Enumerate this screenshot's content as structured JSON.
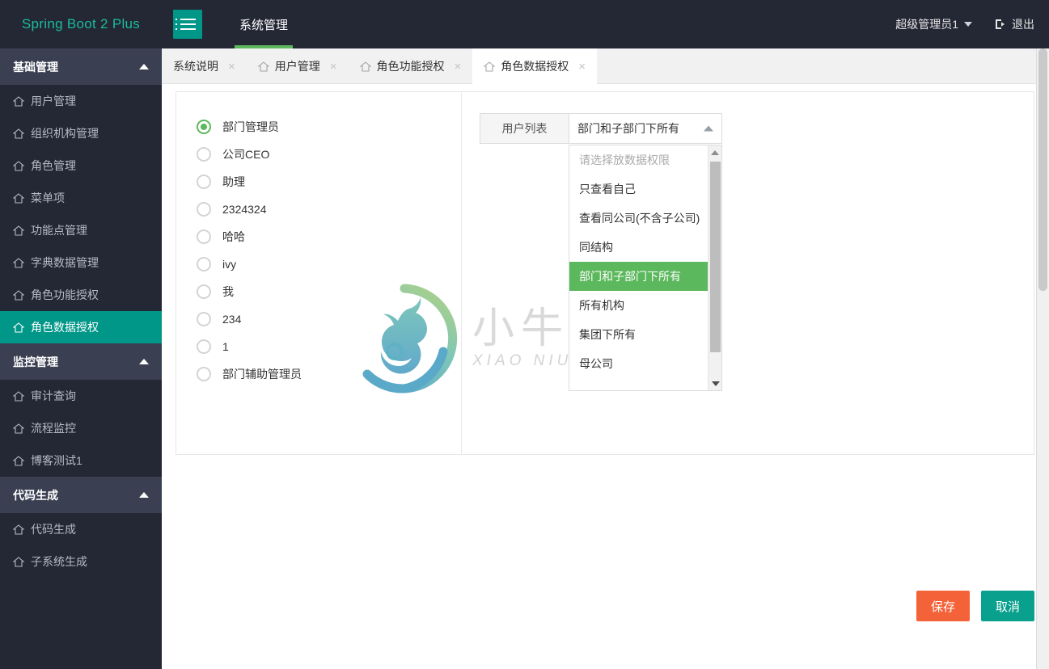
{
  "app": {
    "brand": "Spring Boot 2 Plus",
    "menu_toggle_icon": "hamburger-icon"
  },
  "topnav": {
    "items": [
      {
        "label": "系统管理",
        "active": true
      }
    ],
    "user": "超级管理员1",
    "logout_label": "退出",
    "logout_icon": "logout-icon",
    "caret_icon": "caret-down-icon"
  },
  "sidebar": {
    "groups": [
      {
        "title": "基础管理",
        "collapse_icon": "chevron-up-icon",
        "items": [
          {
            "label": "用户管理",
            "icon": "home-icon",
            "active": false
          },
          {
            "label": "组织机构管理",
            "icon": "home-icon",
            "active": false
          },
          {
            "label": "角色管理",
            "icon": "home-icon",
            "active": false
          },
          {
            "label": "菜单项",
            "icon": "home-icon",
            "active": false
          },
          {
            "label": "功能点管理",
            "icon": "home-icon",
            "active": false
          },
          {
            "label": "字典数据管理",
            "icon": "home-icon",
            "active": false
          },
          {
            "label": "角色功能授权",
            "icon": "home-icon",
            "active": false
          },
          {
            "label": "角色数据授权",
            "icon": "home-icon",
            "active": true
          }
        ]
      },
      {
        "title": "监控管理",
        "collapse_icon": "chevron-up-icon",
        "items": [
          {
            "label": "审计查询",
            "icon": "home-icon",
            "active": false
          },
          {
            "label": "流程监控",
            "icon": "home-icon",
            "active": false
          },
          {
            "label": "博客测试1",
            "icon": "home-icon",
            "active": false
          }
        ]
      },
      {
        "title": "代码生成",
        "collapse_icon": "chevron-up-icon",
        "items": [
          {
            "label": "代码生成",
            "icon": "home-icon",
            "active": false
          },
          {
            "label": "子系统生成",
            "icon": "home-icon",
            "active": false
          }
        ]
      }
    ]
  },
  "tabs": [
    {
      "label": "系统说明",
      "icon": null,
      "close": "×",
      "active": false
    },
    {
      "label": "用户管理",
      "icon": "home-icon",
      "close": "×",
      "active": false
    },
    {
      "label": "角色功能授权",
      "icon": "home-icon",
      "close": "×",
      "active": false
    },
    {
      "label": "角色数据授权",
      "icon": "home-icon",
      "close": "×",
      "active": true
    }
  ],
  "main": {
    "roles": [
      {
        "label": "部门管理员",
        "checked": true
      },
      {
        "label": "公司CEO",
        "checked": false
      },
      {
        "label": "助理",
        "checked": false
      },
      {
        "label": "2324324",
        "checked": false
      },
      {
        "label": "哈哈",
        "checked": false
      },
      {
        "label": "ivy",
        "checked": false
      },
      {
        "label": "我",
        "checked": false
      },
      {
        "label": "234",
        "checked": false
      },
      {
        "label": "1",
        "checked": false
      },
      {
        "label": "部门辅助管理员",
        "checked": false
      }
    ],
    "permission_select": {
      "addon_label": "用户列表",
      "value": "部门和子部门下所有",
      "caret_icon": "caret-up-icon",
      "open": true,
      "options": [
        {
          "label": "请选择放数据权限",
          "placeholder": true,
          "selected": false
        },
        {
          "label": "只查看自己",
          "placeholder": false,
          "selected": false
        },
        {
          "label": "查看同公司(不含子公司)",
          "placeholder": false,
          "selected": false
        },
        {
          "label": "同结构",
          "placeholder": false,
          "selected": false
        },
        {
          "label": "部门和子部门下所有",
          "placeholder": false,
          "selected": true
        },
        {
          "label": "所有机构",
          "placeholder": false,
          "selected": false
        },
        {
          "label": "集团下所有",
          "placeholder": false,
          "selected": false
        },
        {
          "label": "母公司",
          "placeholder": false,
          "selected": false
        }
      ]
    },
    "watermark": {
      "cn": "小牛知识库",
      "en": "XIAO NIU ZHI SHI KU",
      "logo_icon": "bull-logo-icon"
    },
    "buttons": {
      "save": "保存",
      "cancel": "取消"
    }
  },
  "colors": {
    "topbar_bg": "#242734",
    "brand_text": "#1abc9c",
    "hamburger_bg": "#009688",
    "topnav_underline": "#5cb85c",
    "sidebar_bg": "#242734",
    "sidebar_group_bg": "#3a3f51",
    "sidebar_active_bg": "#009688",
    "radio_accent": "#5cb85c",
    "dropdown_selected_bg": "#5cb85c",
    "save_button_bg": "#f4623a",
    "cancel_button_bg": "#0aa08e"
  }
}
